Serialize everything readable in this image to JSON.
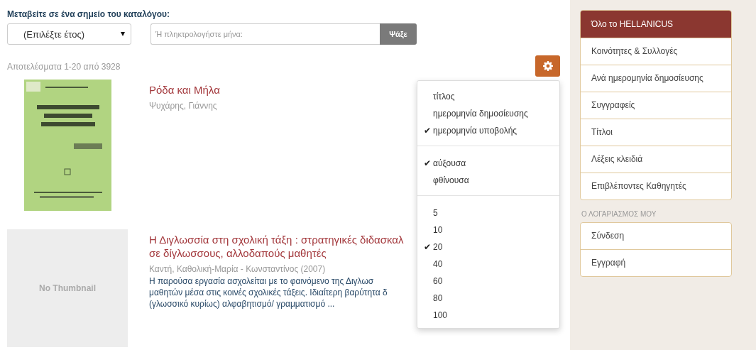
{
  "jump": {
    "heading": "Μεταβείτε σε ένα σημείο του καταλόγου:",
    "year_select": "(Επιλέξτε έτος)",
    "month_field": {
      "placeholder": "Ή πληκτρολογήστε μήνα:"
    },
    "button": "Ψάξε"
  },
  "results_count": "Αποτελέσματα 1-20 από 3928",
  "results": [
    {
      "thumbnail": {
        "kind": "picture"
      },
      "title_lines": [
        "Ρόδα και Μήλα"
      ],
      "author": "Ψυχάρης, Γιάννης"
    },
    {
      "thumbnail": {
        "kind": "placeholder",
        "text": "No Thumbnail"
      },
      "title_lines": [
        "Η Διγλωσσία στη σχολική τάξη : στρατηγικές διδασκαλ",
        "σε δίγλωσσους, αλλοδαπούς μαθητές"
      ],
      "author": "Καντή, Καθολική-Μαρία - Κωνσταντίνος (2007)",
      "abstract_lines": [
        "Η παρούσα εργασία ασχολείται με το φαινόμενο της Διγλωσ",
        "μαθητών μέσα στις κοινές σχολικές τάξεις. Ιδιαίτερη βαρύτητα δ",
        "(γλωσσικό κυρίως) αλφαβητισμό/ γραμματισμό ..."
      ]
    }
  ],
  "sort_menu": {
    "sections": [
      {
        "items": [
          {
            "label": "τίτλος",
            "selected": false
          },
          {
            "label": "ημερομηνία δημοσίευσης",
            "selected": false
          },
          {
            "label": "ημερομηνία υποβολής",
            "selected": true
          }
        ]
      },
      {
        "items": [
          {
            "label": "αύξουσα",
            "selected": true
          },
          {
            "label": "φθίνουσα",
            "selected": false
          }
        ]
      },
      {
        "items": [
          {
            "label": "5",
            "selected": false
          },
          {
            "label": "10",
            "selected": false
          },
          {
            "label": "20",
            "selected": true
          },
          {
            "label": "40",
            "selected": false
          },
          {
            "label": "60",
            "selected": false
          },
          {
            "label": "80",
            "selected": false
          },
          {
            "label": "100",
            "selected": false
          }
        ]
      }
    ],
    "check": "✔"
  },
  "sidebar": {
    "sections": [
      {
        "items": [
          {
            "label": "Όλο το HELLANICUS",
            "selected": true
          },
          {
            "label": "Κοινότητες & Συλλογές",
            "selected": false
          },
          {
            "label": "Ανά ημερομηνία δημοσίευσης",
            "selected": false
          },
          {
            "label": "Συγγραφείς",
            "selected": false
          },
          {
            "label": "Τίτλοι",
            "selected": false
          },
          {
            "label": "Λέξεις κλειδιά",
            "selected": false
          },
          {
            "label": "Επιβλέποντες Καθηγητές",
            "selected": false
          }
        ]
      },
      {
        "heading": "Ο ΛΟΓΑΡΙΑΣΜΟΣ ΜΟΥ",
        "items": [
          {
            "label": "Σύνδεση",
            "selected": false
          },
          {
            "label": "Εγγραφή",
            "selected": false
          }
        ]
      }
    ]
  }
}
